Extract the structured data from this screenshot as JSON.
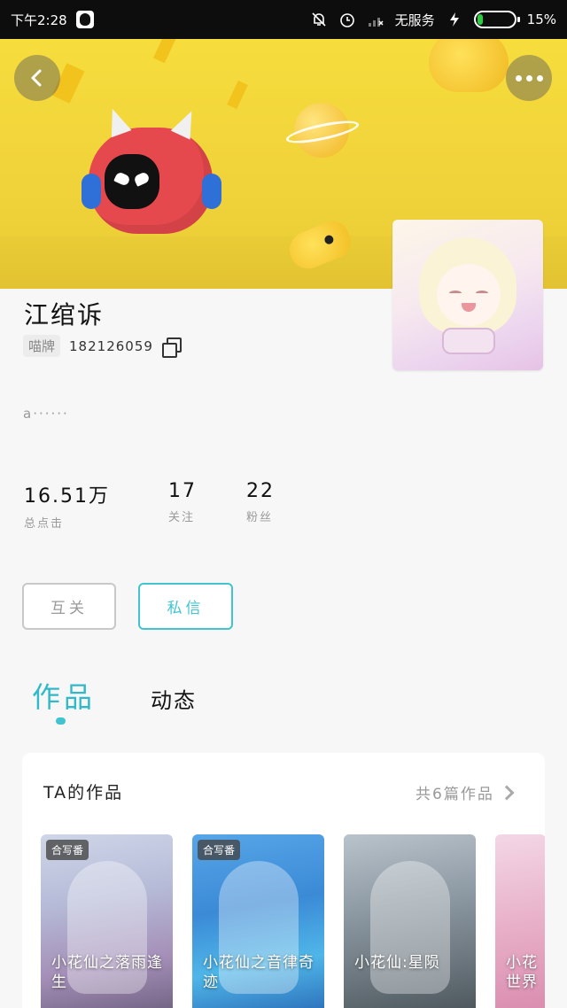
{
  "status_bar": {
    "time": "下午2:28",
    "carrier": "无服务",
    "battery": "15%",
    "battery_level": 0.15
  },
  "header": {
    "back_icon": "chevron-left-icon",
    "more_icon": "more-dots-icon"
  },
  "profile": {
    "name": "江绾诉",
    "id_label": "喵牌",
    "id_number": "182126059",
    "signature": "a······",
    "stats": [
      {
        "value": "16.51万",
        "label": "总点击"
      },
      {
        "value": "17",
        "label": "关注"
      },
      {
        "value": "22",
        "label": "粉丝"
      }
    ],
    "follow_button": "互关",
    "message_button": "私信"
  },
  "tabs": {
    "works": "作品",
    "dynamics": "动态"
  },
  "works_section": {
    "title": "TA的作品",
    "count_text": "共6篇作品",
    "items": [
      {
        "badge": "合写番",
        "title": "小花仙之落雨逢生"
      },
      {
        "badge": "合写番",
        "title": "小花仙之音律奇迹"
      },
      {
        "badge": "",
        "title": "小花仙:星陨"
      },
      {
        "badge": "",
        "title": "小花世界"
      }
    ]
  },
  "colors": {
    "accent": "#41c4cf",
    "banner": "#f2d43a"
  }
}
